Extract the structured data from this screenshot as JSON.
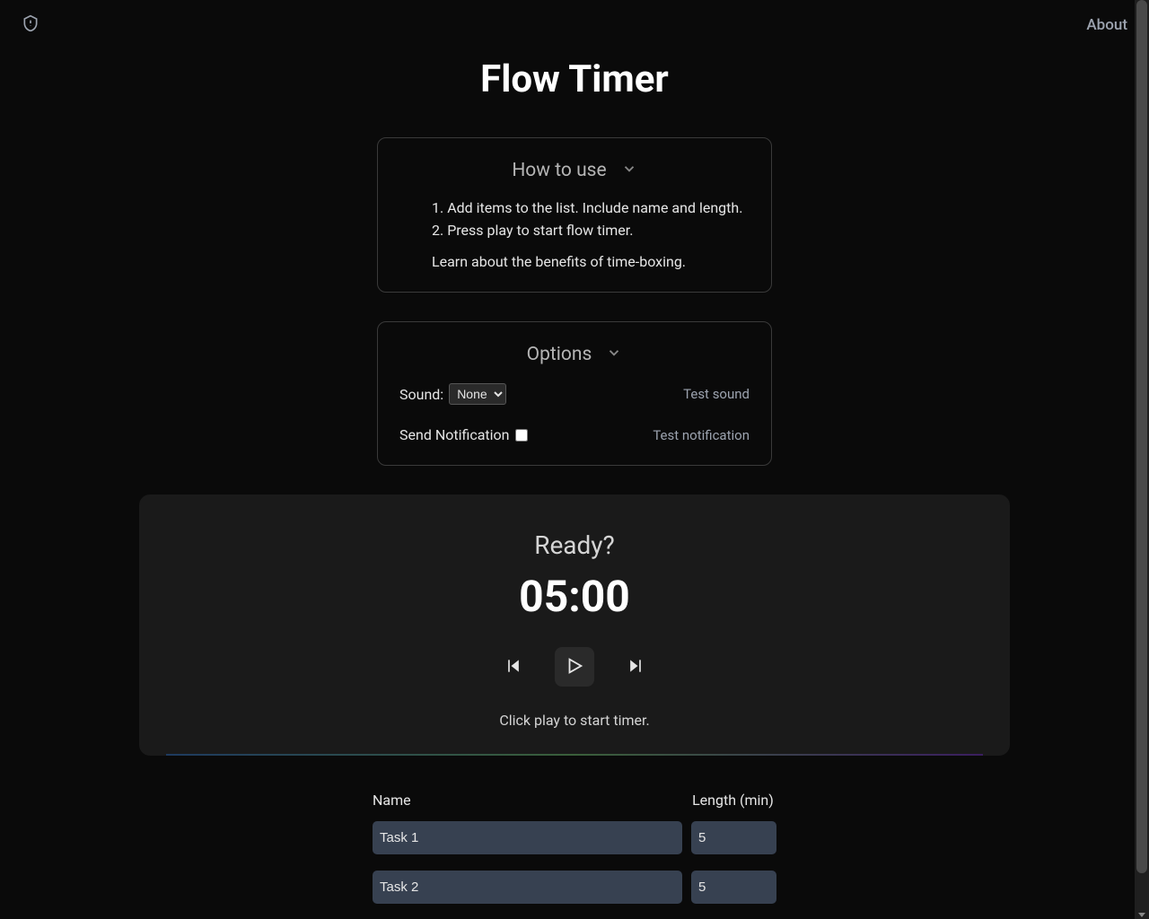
{
  "header": {
    "about_label": "About"
  },
  "title": "Flow Timer",
  "how_to_use": {
    "title": "How to use",
    "step_1": "Add items to the list. Include name and length.",
    "step_2": "Press play to start flow timer.",
    "learn_more": "Learn about the benefits of time-boxing."
  },
  "options": {
    "title": "Options",
    "sound_label": "Sound:",
    "sound_selected": "None",
    "test_sound_label": "Test sound",
    "notification_label": "Send Notification",
    "test_notification_label": "Test notification"
  },
  "timer": {
    "status": "Ready?",
    "display": "05:00",
    "hint": "Click play to start timer."
  },
  "tasks": {
    "name_header": "Name",
    "length_header": "Length (min)",
    "rows": [
      {
        "name": "Task 1",
        "length": "5"
      },
      {
        "name": "Task 2",
        "length": "5"
      }
    ]
  }
}
